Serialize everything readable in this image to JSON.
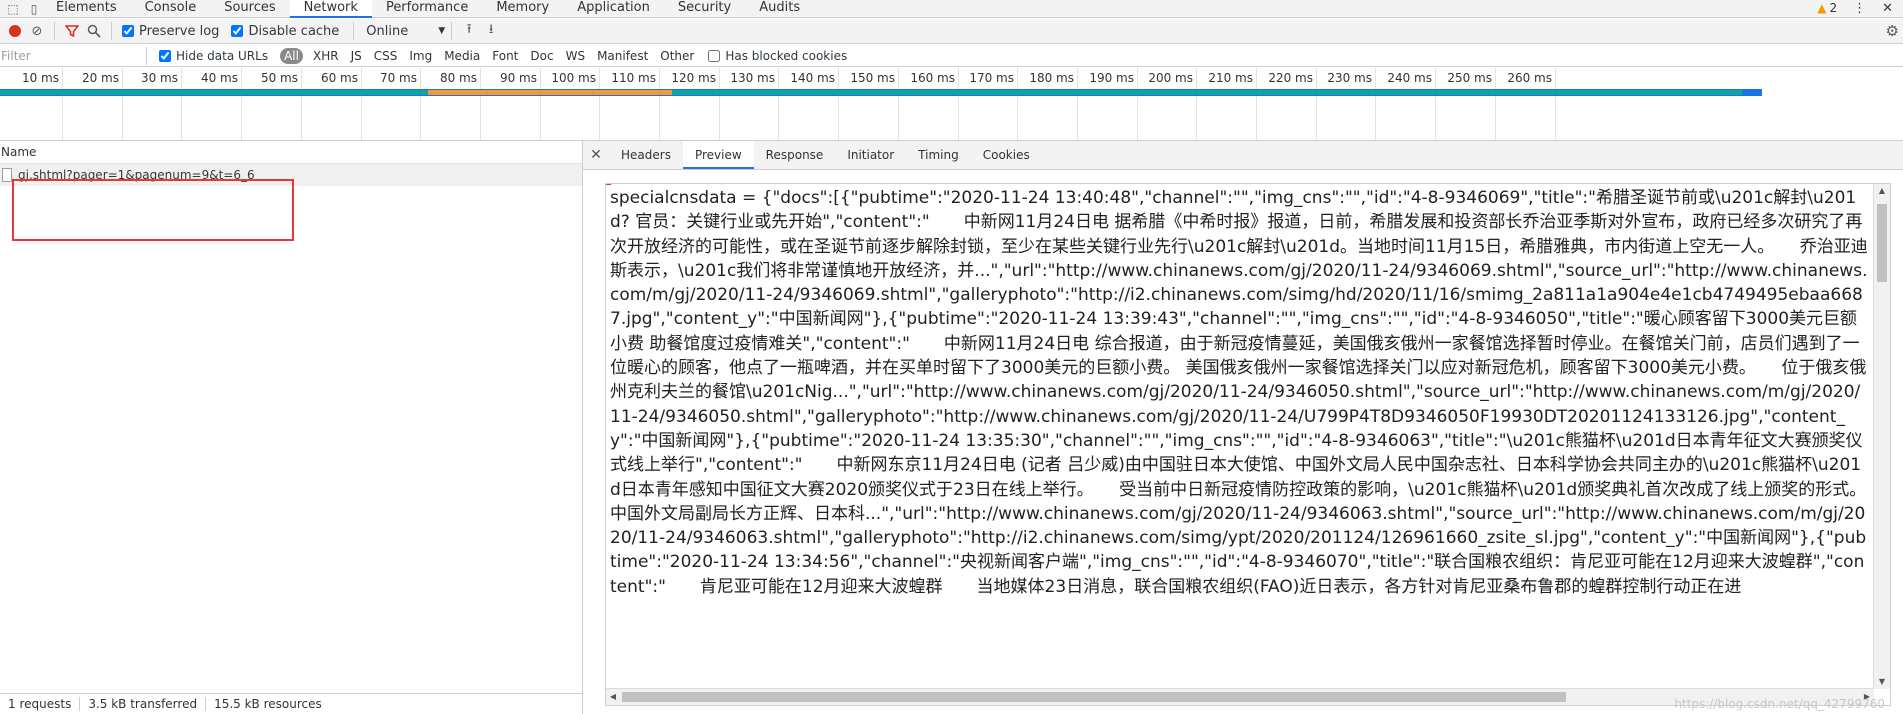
{
  "devtools": {
    "tabs": [
      "Elements",
      "Console",
      "Sources",
      "Network",
      "Performance",
      "Memory",
      "Application",
      "Security",
      "Audits"
    ],
    "active_tab": "Network",
    "warning_count": "2"
  },
  "toolbar": {
    "preserve_log": "Preserve log",
    "disable_cache": "Disable cache",
    "throttle": "Online"
  },
  "filterbar": {
    "placeholder": "Filter",
    "hide_data_urls": "Hide data URLs",
    "types": [
      "All",
      "XHR",
      "JS",
      "CSS",
      "Img",
      "Media",
      "Font",
      "Doc",
      "WS",
      "Manifest",
      "Other"
    ],
    "has_blocked_cookies": "Has blocked cookies"
  },
  "timeline": {
    "ticks": [
      "10 ms",
      "20 ms",
      "30 ms",
      "40 ms",
      "50 ms",
      "60 ms",
      "70 ms",
      "80 ms",
      "90 ms",
      "100 ms",
      "110 ms",
      "120 ms",
      "130 ms",
      "140 ms",
      "150 ms",
      "160 ms",
      "170 ms",
      "180 ms",
      "190 ms",
      "200 ms",
      "210 ms",
      "220 ms",
      "230 ms",
      "240 ms",
      "250 ms",
      "260 ms"
    ]
  },
  "list": {
    "header": "Name",
    "row_name": "gj.shtml?pager=1&pagenum=9&t=6_6"
  },
  "status": {
    "requests": "1 requests",
    "transferred": "3.5 kB transferred",
    "resources": "15.5 kB resources"
  },
  "detail": {
    "tabs": [
      "Headers",
      "Preview",
      "Response",
      "Initiator",
      "Timing",
      "Cookies"
    ],
    "active_tab": "Preview",
    "preview": "specialcnsdata = {\"docs\":[{\"pubtime\":\"2020-11-24 13:40:48\",\"channel\":\"\",\"img_cns\":\"\",\"id\":\"4-8-9346069\",\"title\":\"希腊圣诞节前或\\u201c解封\\u201d? 官员：关键行业或先开始\",\"content\":\"　　中新网11月24日电 据希腊《中希时报》报道，日前，希腊发展和投资部长乔治亚季斯对外宣布，政府已经多次研究了再次开放经济的可能性，或在圣诞节前逐步解除封锁，至少在某些关键行业先行\\u201c解封\\u201d。当地时间11月15日，希腊雅典，市内街道上空无一人。　　乔治亚迪斯表示，\\u201c我们将非常谨慎地开放经济，并...\",\"url\":\"http://www.chinanews.com/gj/2020/11-24/9346069.shtml\",\"source_url\":\"http://www.chinanews.com/m/gj/2020/11-24/9346069.shtml\",\"galleryphoto\":\"http://i2.chinanews.com/simg/hd/2020/11/16/smimg_2a811a1a904e4e1cb4749495ebaa6687.jpg\",\"content_y\":\"中国新闻网\"},{\"pubtime\":\"2020-11-24 13:39:43\",\"channel\":\"\",\"img_cns\":\"\",\"id\":\"4-8-9346050\",\"title\":\"暖心顾客留下3000美元巨额小费 助餐馆度过疫情难关\",\"content\":\"　　中新网11月24日电 综合报道，由于新冠疫情蔓延，美国俄亥俄州一家餐馆选择暂时停业。在餐馆关门前，店员们遇到了一位暖心的顾客，他点了一瓶啤酒，并在买单时留下了3000美元的巨额小费。 美国俄亥俄州一家餐馆选择关门以应对新冠危机，顾客留下3000美元小费。　　位于俄亥俄州克利夫兰的餐馆\\u201cNig...\",\"url\":\"http://www.chinanews.com/gj/2020/11-24/9346050.shtml\",\"source_url\":\"http://www.chinanews.com/m/gj/2020/11-24/9346050.shtml\",\"galleryphoto\":\"http://www.chinanews.com/gj/2020/11-24/U799P4T8D9346050F19930DT20201124133126.jpg\",\"content_y\":\"中国新闻网\"},{\"pubtime\":\"2020-11-24 13:35:30\",\"channel\":\"\",\"img_cns\":\"\",\"id\":\"4-8-9346063\",\"title\":\"\\u201c熊猫杯\\u201d日本青年征文大赛颁奖仪式线上举行\",\"content\":\"　　中新网东京11月24日电 (记者 吕少威)由中国驻日本大使馆、中国外文局人民中国杂志社、日本科学协会共同主办的\\u201c熊猫杯\\u201d日本青年感知中国征文大赛2020颁奖仪式于23日在线上举行。　　受当前中日新冠疫情防控政策的影响，\\u201c熊猫杯\\u201d颁奖典礼首次改成了线上颁奖的形式。中国外文局副局长方正辉、日本科...\",\"url\":\"http://www.chinanews.com/gj/2020/11-24/9346063.shtml\",\"source_url\":\"http://www.chinanews.com/m/gj/2020/11-24/9346063.shtml\",\"galleryphoto\":\"http://i2.chinanews.com/simg/ypt/2020/201124/126961660_zsite_sl.jpg\",\"content_y\":\"中国新闻网\"},{\"pubtime\":\"2020-11-24 13:34:56\",\"channel\":\"央视新闻客户端\",\"img_cns\":\"\",\"id\":\"4-8-9346070\",\"title\":\"联合国粮农组织：肯尼亚可能在12月迎来大波蝗群\",\"content\":\"　　肯尼亚可能在12月迎来大波蝗群　　当地媒体23日消息，联合国粮农组织(FAO)近日表示，各方针对肯尼亚桑布鲁郡的蝗群控制行动正在进",
    "watermark": "https://blog.csdn.net/qq_42799760"
  },
  "colors": {
    "accent": "#1a73e8",
    "record": "#d93025",
    "highlight_box": "#e53935",
    "timeline_orange": "#f39c2c",
    "timeline_teal": "#12a3a0"
  }
}
